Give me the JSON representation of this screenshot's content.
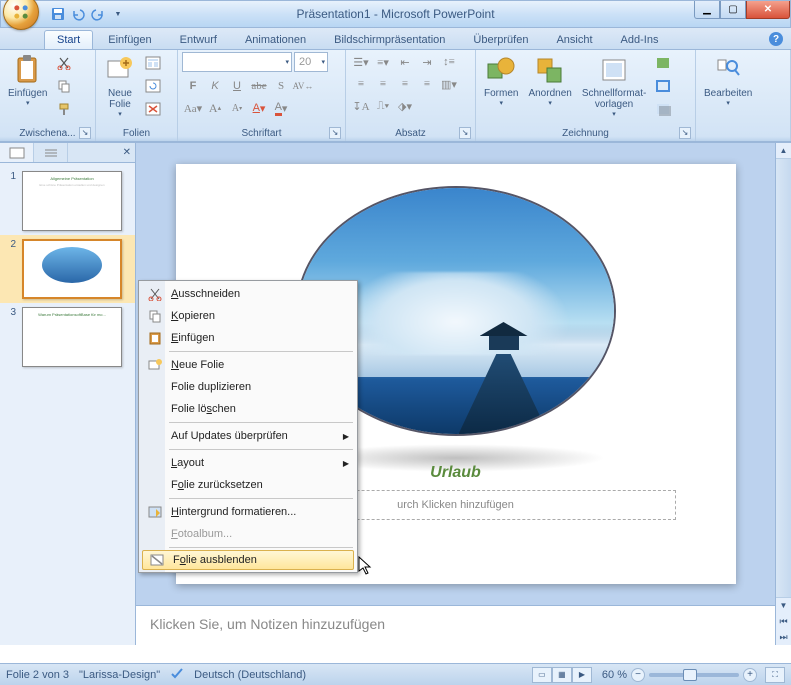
{
  "window": {
    "title": "Präsentation1 - Microsoft PowerPoint"
  },
  "tabs": {
    "start": "Start",
    "insert": "Einfügen",
    "design": "Entwurf",
    "anim": "Animationen",
    "show": "Bildschirmpräsentation",
    "review": "Überprüfen",
    "view": "Ansicht",
    "addins": "Add-Ins"
  },
  "ribbon": {
    "clipboard": {
      "label": "Zwischena...",
      "paste": "Einfügen"
    },
    "slides": {
      "label": "Folien",
      "new_slide": "Neue\nFolie"
    },
    "font": {
      "label": "Schriftart",
      "size_value": "20"
    },
    "para": {
      "label": "Absatz"
    },
    "draw": {
      "label": "Zeichnung",
      "shapes": "Formen",
      "arrange": "Anordnen",
      "quick": "Schnellformat-\nvorlagen"
    },
    "edit": {
      "label": "",
      "editing": "Bearbeiten"
    }
  },
  "slide": {
    "title": "Urlaub",
    "subtitle_placeholder": "urch Klicken hinzufügen"
  },
  "thumbs": {
    "s1": {
      "num": "1",
      "title": "Allgemeine Präsentation",
      "sub": "Eine schöne Präsentation erstellen und designen"
    },
    "s2": {
      "num": "2"
    },
    "s3": {
      "num": "3",
      "title": "Warum PräsentationsoftBase für mo..."
    }
  },
  "notes": {
    "placeholder": "Klicken Sie, um Notizen hinzuzufügen"
  },
  "context_menu": {
    "cut": "Ausschneiden",
    "copy": "Kopieren",
    "paste": "Einfügen",
    "new_slide": "Neue Folie",
    "duplicate": "Folie duplizieren",
    "delete": "Folie löschen",
    "updates": "Auf Updates überprüfen",
    "layout": "Layout",
    "reset": "Folie zurücksetzen",
    "format_bg": "Hintergrund formatieren...",
    "photo_album": "Fotoalbum...",
    "hide_slide": "Folie ausblenden"
  },
  "status": {
    "slide_of": "Folie 2 von 3",
    "theme": "\"Larissa-Design\"",
    "lang": "Deutsch (Deutschland)",
    "zoom": "60 %"
  }
}
